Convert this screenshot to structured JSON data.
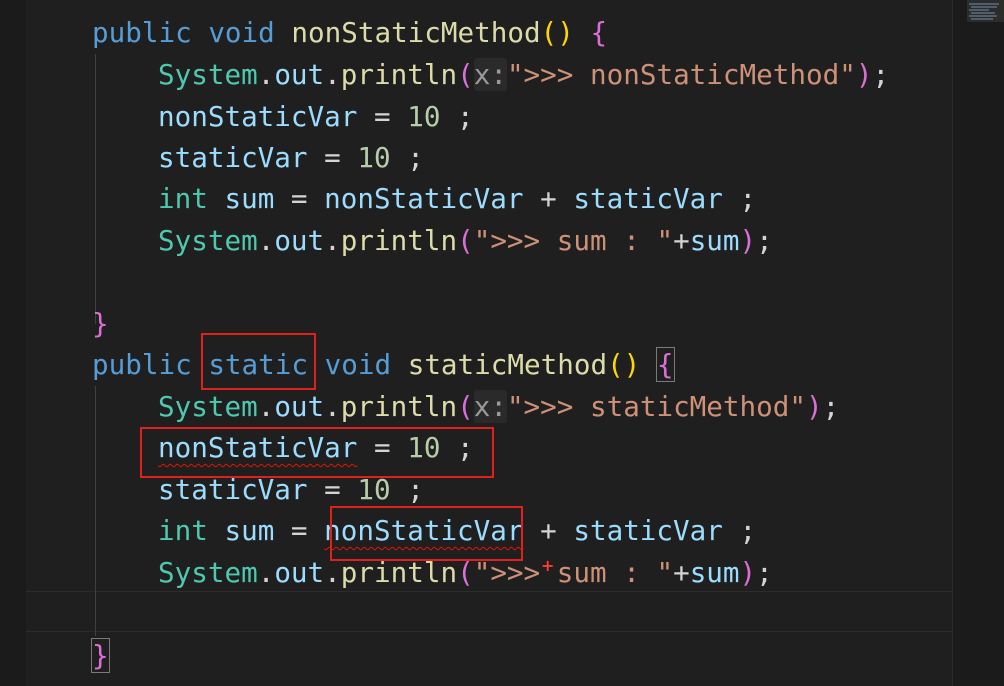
{
  "editor": {
    "lines": [
      {
        "id": "L1",
        "tokens": [
          {
            "t": "public",
            "c": "kw"
          },
          {
            "t": " ",
            "c": "pu"
          },
          {
            "t": "void",
            "c": "kw"
          },
          {
            "t": " ",
            "c": "pu"
          },
          {
            "t": "nonStaticMethod",
            "c": "fn"
          },
          {
            "t": "()",
            "c": "br2"
          },
          {
            "t": " ",
            "c": "pu"
          },
          {
            "t": "{",
            "c": "br"
          }
        ]
      },
      {
        "id": "L2",
        "tokens": [
          {
            "t": "System",
            "c": "ty"
          },
          {
            "t": ".",
            "c": "pu"
          },
          {
            "t": "out",
            "c": "vr"
          },
          {
            "t": ".",
            "c": "pu"
          },
          {
            "t": "println",
            "c": "fn"
          },
          {
            "t": "(",
            "c": "br"
          },
          {
            "t": "x:",
            "c": "hint"
          },
          {
            "t": "\">>> nonStaticMethod\"",
            "c": "st"
          },
          {
            "t": ")",
            "c": "br"
          },
          {
            "t": ";",
            "c": "pu"
          }
        ]
      },
      {
        "id": "L3",
        "tokens": [
          {
            "t": "nonStaticVar",
            "c": "vr"
          },
          {
            "t": " = ",
            "c": "pu"
          },
          {
            "t": "10",
            "c": "nm"
          },
          {
            "t": " ;",
            "c": "pu"
          }
        ]
      },
      {
        "id": "L4",
        "tokens": [
          {
            "t": "staticVar",
            "c": "vr"
          },
          {
            "t": " = ",
            "c": "pu"
          },
          {
            "t": "10",
            "c": "nm"
          },
          {
            "t": " ;",
            "c": "pu"
          }
        ]
      },
      {
        "id": "L5",
        "tokens": [
          {
            "t": "int",
            "c": "ty"
          },
          {
            "t": " ",
            "c": "pu"
          },
          {
            "t": "sum",
            "c": "vr"
          },
          {
            "t": " = ",
            "c": "pu"
          },
          {
            "t": "nonStaticVar",
            "c": "vr"
          },
          {
            "t": " + ",
            "c": "pu"
          },
          {
            "t": "staticVar",
            "c": "vr"
          },
          {
            "t": " ;",
            "c": "pu"
          }
        ]
      },
      {
        "id": "L6",
        "tokens": [
          {
            "t": "System",
            "c": "ty"
          },
          {
            "t": ".",
            "c": "pu"
          },
          {
            "t": "out",
            "c": "vr"
          },
          {
            "t": ".",
            "c": "pu"
          },
          {
            "t": "println",
            "c": "fn"
          },
          {
            "t": "(",
            "c": "br"
          },
          {
            "t": "\">>> sum : \"",
            "c": "st"
          },
          {
            "t": "+",
            "c": "pu"
          },
          {
            "t": "sum",
            "c": "vr"
          },
          {
            "t": ")",
            "c": "br"
          },
          {
            "t": ";",
            "c": "pu"
          }
        ]
      },
      {
        "id": "L7",
        "tokens": []
      },
      {
        "id": "L8",
        "tokens": [
          {
            "t": "}",
            "c": "br"
          }
        ]
      },
      {
        "id": "L9",
        "tokens": [
          {
            "t": "public",
            "c": "kw"
          },
          {
            "t": " ",
            "c": "pu"
          },
          {
            "t": "static",
            "c": "kw"
          },
          {
            "t": " ",
            "c": "pu"
          },
          {
            "t": "void",
            "c": "kw"
          },
          {
            "t": " ",
            "c": "pu"
          },
          {
            "t": "staticMethod",
            "c": "fn"
          },
          {
            "t": "()",
            "c": "br2"
          },
          {
            "t": " ",
            "c": "pu"
          },
          {
            "t": "{",
            "c": "br bracket-match"
          }
        ]
      },
      {
        "id": "L10",
        "tokens": [
          {
            "t": "System",
            "c": "ty"
          },
          {
            "t": ".",
            "c": "pu"
          },
          {
            "t": "out",
            "c": "vr"
          },
          {
            "t": ".",
            "c": "pu"
          },
          {
            "t": "println",
            "c": "fn"
          },
          {
            "t": "(",
            "c": "br"
          },
          {
            "t": "x:",
            "c": "hint"
          },
          {
            "t": "\">>> staticMethod\"",
            "c": "st"
          },
          {
            "t": ")",
            "c": "br"
          },
          {
            "t": ";",
            "c": "pu"
          }
        ]
      },
      {
        "id": "L11",
        "tokens": [
          {
            "t": "nonStaticVar",
            "c": "vr squiggle"
          },
          {
            "t": " = ",
            "c": "pu"
          },
          {
            "t": "10",
            "c": "nm"
          },
          {
            "t": " ;",
            "c": "pu"
          }
        ]
      },
      {
        "id": "L12",
        "tokens": [
          {
            "t": "staticVar",
            "c": "vr"
          },
          {
            "t": " = ",
            "c": "pu"
          },
          {
            "t": "10",
            "c": "nm"
          },
          {
            "t": " ;",
            "c": "pu"
          }
        ]
      },
      {
        "id": "L13",
        "tokens": [
          {
            "t": "int",
            "c": "ty"
          },
          {
            "t": " ",
            "c": "pu"
          },
          {
            "t": "sum",
            "c": "vr"
          },
          {
            "t": " = ",
            "c": "pu"
          },
          {
            "t": "nonStaticVar",
            "c": "vr squiggle"
          },
          {
            "t": " + ",
            "c": "pu"
          },
          {
            "t": "staticVar",
            "c": "vr"
          },
          {
            "t": " ;",
            "c": "pu"
          }
        ]
      },
      {
        "id": "L14",
        "tokens": [
          {
            "t": "System",
            "c": "ty"
          },
          {
            "t": ".",
            "c": "pu"
          },
          {
            "t": "out",
            "c": "vr"
          },
          {
            "t": ".",
            "c": "pu"
          },
          {
            "t": "println",
            "c": "fn"
          },
          {
            "t": "(",
            "c": "br"
          },
          {
            "t": "\">>> sum : \"",
            "c": "st"
          },
          {
            "t": "+",
            "c": "pu"
          },
          {
            "t": "sum",
            "c": "vr"
          },
          {
            "t": ")",
            "c": "br"
          },
          {
            "t": ";",
            "c": "pu"
          }
        ]
      },
      {
        "id": "L15",
        "tokens": []
      },
      {
        "id": "L16",
        "tokens": [
          {
            "t": "}",
            "c": "br bracket-match"
          }
        ]
      }
    ],
    "annotation_marker": "+",
    "colors": {
      "background": "#1f1f1f",
      "keyword": "#569cd6",
      "type": "#4ec9b0",
      "function": "#dcdcaa",
      "variable": "#9cdcfe",
      "string": "#ce9178",
      "number": "#b5cea8",
      "annotation_box": "#e0201a",
      "error_squiggle": "#e51400"
    }
  }
}
